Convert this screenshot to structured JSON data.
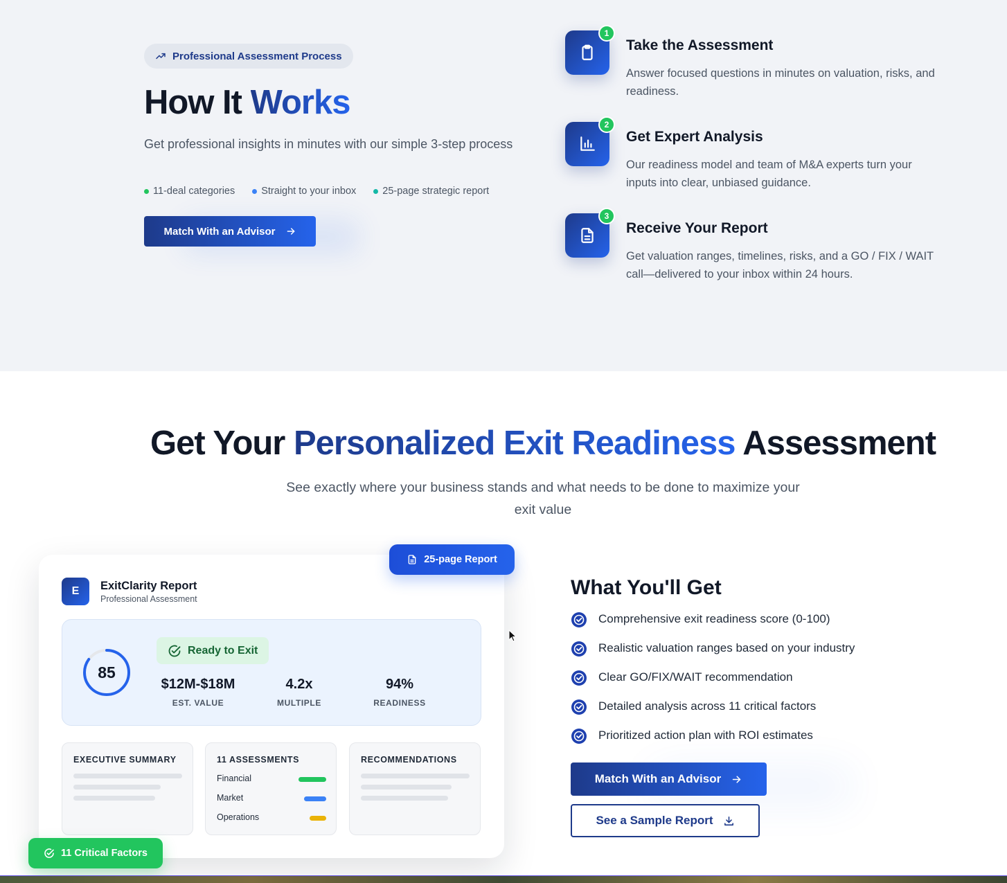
{
  "how": {
    "pill": "Professional Assessment Process",
    "title_plain": "How It ",
    "title_accent": "Works",
    "subtitle": "Get professional insights in minutes with our simple 3-step process",
    "bullets": [
      {
        "label": "11-deal categories",
        "color": "#22c55e"
      },
      {
        "label": "Straight to your inbox",
        "color": "#3b82f6"
      },
      {
        "label": "25-page strategic report",
        "color": "#14b8a6"
      }
    ],
    "cta": "Match With an Advisor",
    "steps": [
      {
        "num": "1",
        "icon": "clipboard-icon",
        "title": "Take the Assessment",
        "desc": "Answer focused questions in minutes on valuation, risks, and readiness."
      },
      {
        "num": "2",
        "icon": "bar-chart-icon",
        "title": "Get Expert Analysis",
        "desc": "Our readiness model and team of M&A experts turn your inputs into clear, unbiased guidance."
      },
      {
        "num": "3",
        "icon": "document-icon",
        "title": "Receive Your Report",
        "desc": "Get valuation ranges, timelines, risks, and a GO / FIX / WAIT call—delivered to your inbox within 24 hours."
      }
    ]
  },
  "get": {
    "title_a": "Get Your ",
    "title_accent": "Personalized Exit Readiness",
    "title_b": " Assessment",
    "subtitle": "See exactly where your business stands and what needs to be done to maximize your exit value"
  },
  "report": {
    "badge": "25-page Report",
    "logo_letter": "E",
    "name": "ExitClarity Report",
    "type": "Professional Assessment",
    "score": "85",
    "score_fraction": 0.85,
    "status": "Ready to Exit",
    "metrics": [
      {
        "value": "$12M-$18M",
        "label": "EST. VALUE"
      },
      {
        "value": "4.2x",
        "label": "MULTIPLE"
      },
      {
        "value": "94%",
        "label": "READINESS"
      }
    ],
    "exec_summary": "EXECUTIVE SUMMARY",
    "assessments_title": "11 ASSESSMENTS",
    "factors": [
      {
        "label": "Financial",
        "color": "#22c55e"
      },
      {
        "label": "Market",
        "color": "#3b82f6"
      },
      {
        "label": "Operations",
        "color": "#eab308"
      }
    ],
    "recommendations": "RECOMMENDATIONS",
    "critical_badge": "11 Critical Factors"
  },
  "wyg": {
    "title": "What You'll Get",
    "items": [
      "Comprehensive exit readiness score (0-100)",
      "Realistic valuation ranges based on your industry",
      "Clear GO/FIX/WAIT recommendation",
      "Detailed analysis across 11 critical factors",
      "Prioritized action plan with ROI estimates"
    ],
    "cta_primary": "Match With an Advisor",
    "cta_secondary": "See a Sample Report"
  }
}
